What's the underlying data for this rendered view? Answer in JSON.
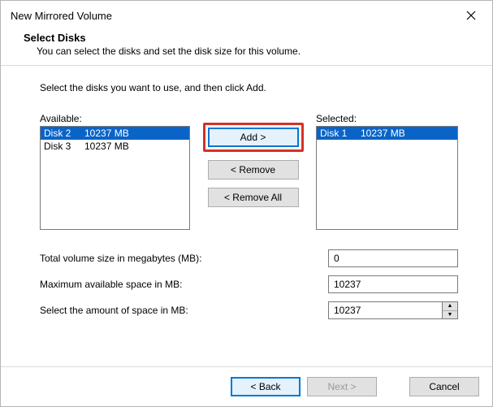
{
  "window": {
    "title": "New Mirrored Volume"
  },
  "header": {
    "heading": "Select Disks",
    "subtext": "You can select the disks and set the disk size for this volume."
  },
  "instruction": "Select the disks you want to use, and then click Add.",
  "labels": {
    "available": "Available:",
    "selected": "Selected:"
  },
  "available": [
    {
      "name": "Disk 2",
      "size": "10237 MB",
      "selected": true
    },
    {
      "name": "Disk 3",
      "size": "10237 MB",
      "selected": false
    }
  ],
  "selected": [
    {
      "name": "Disk 1",
      "size": "10237 MB",
      "selected": true
    }
  ],
  "buttons": {
    "add": "Add >",
    "remove": "< Remove",
    "remove_all": "< Remove All",
    "back": "< Back",
    "next": "Next >",
    "cancel": "Cancel"
  },
  "form": {
    "total_label": "Total volume size in megabytes (MB):",
    "total_value": "0",
    "max_label": "Maximum available space in MB:",
    "max_value": "10237",
    "amount_label": "Select the amount of space in MB:",
    "amount_value": "10237"
  }
}
